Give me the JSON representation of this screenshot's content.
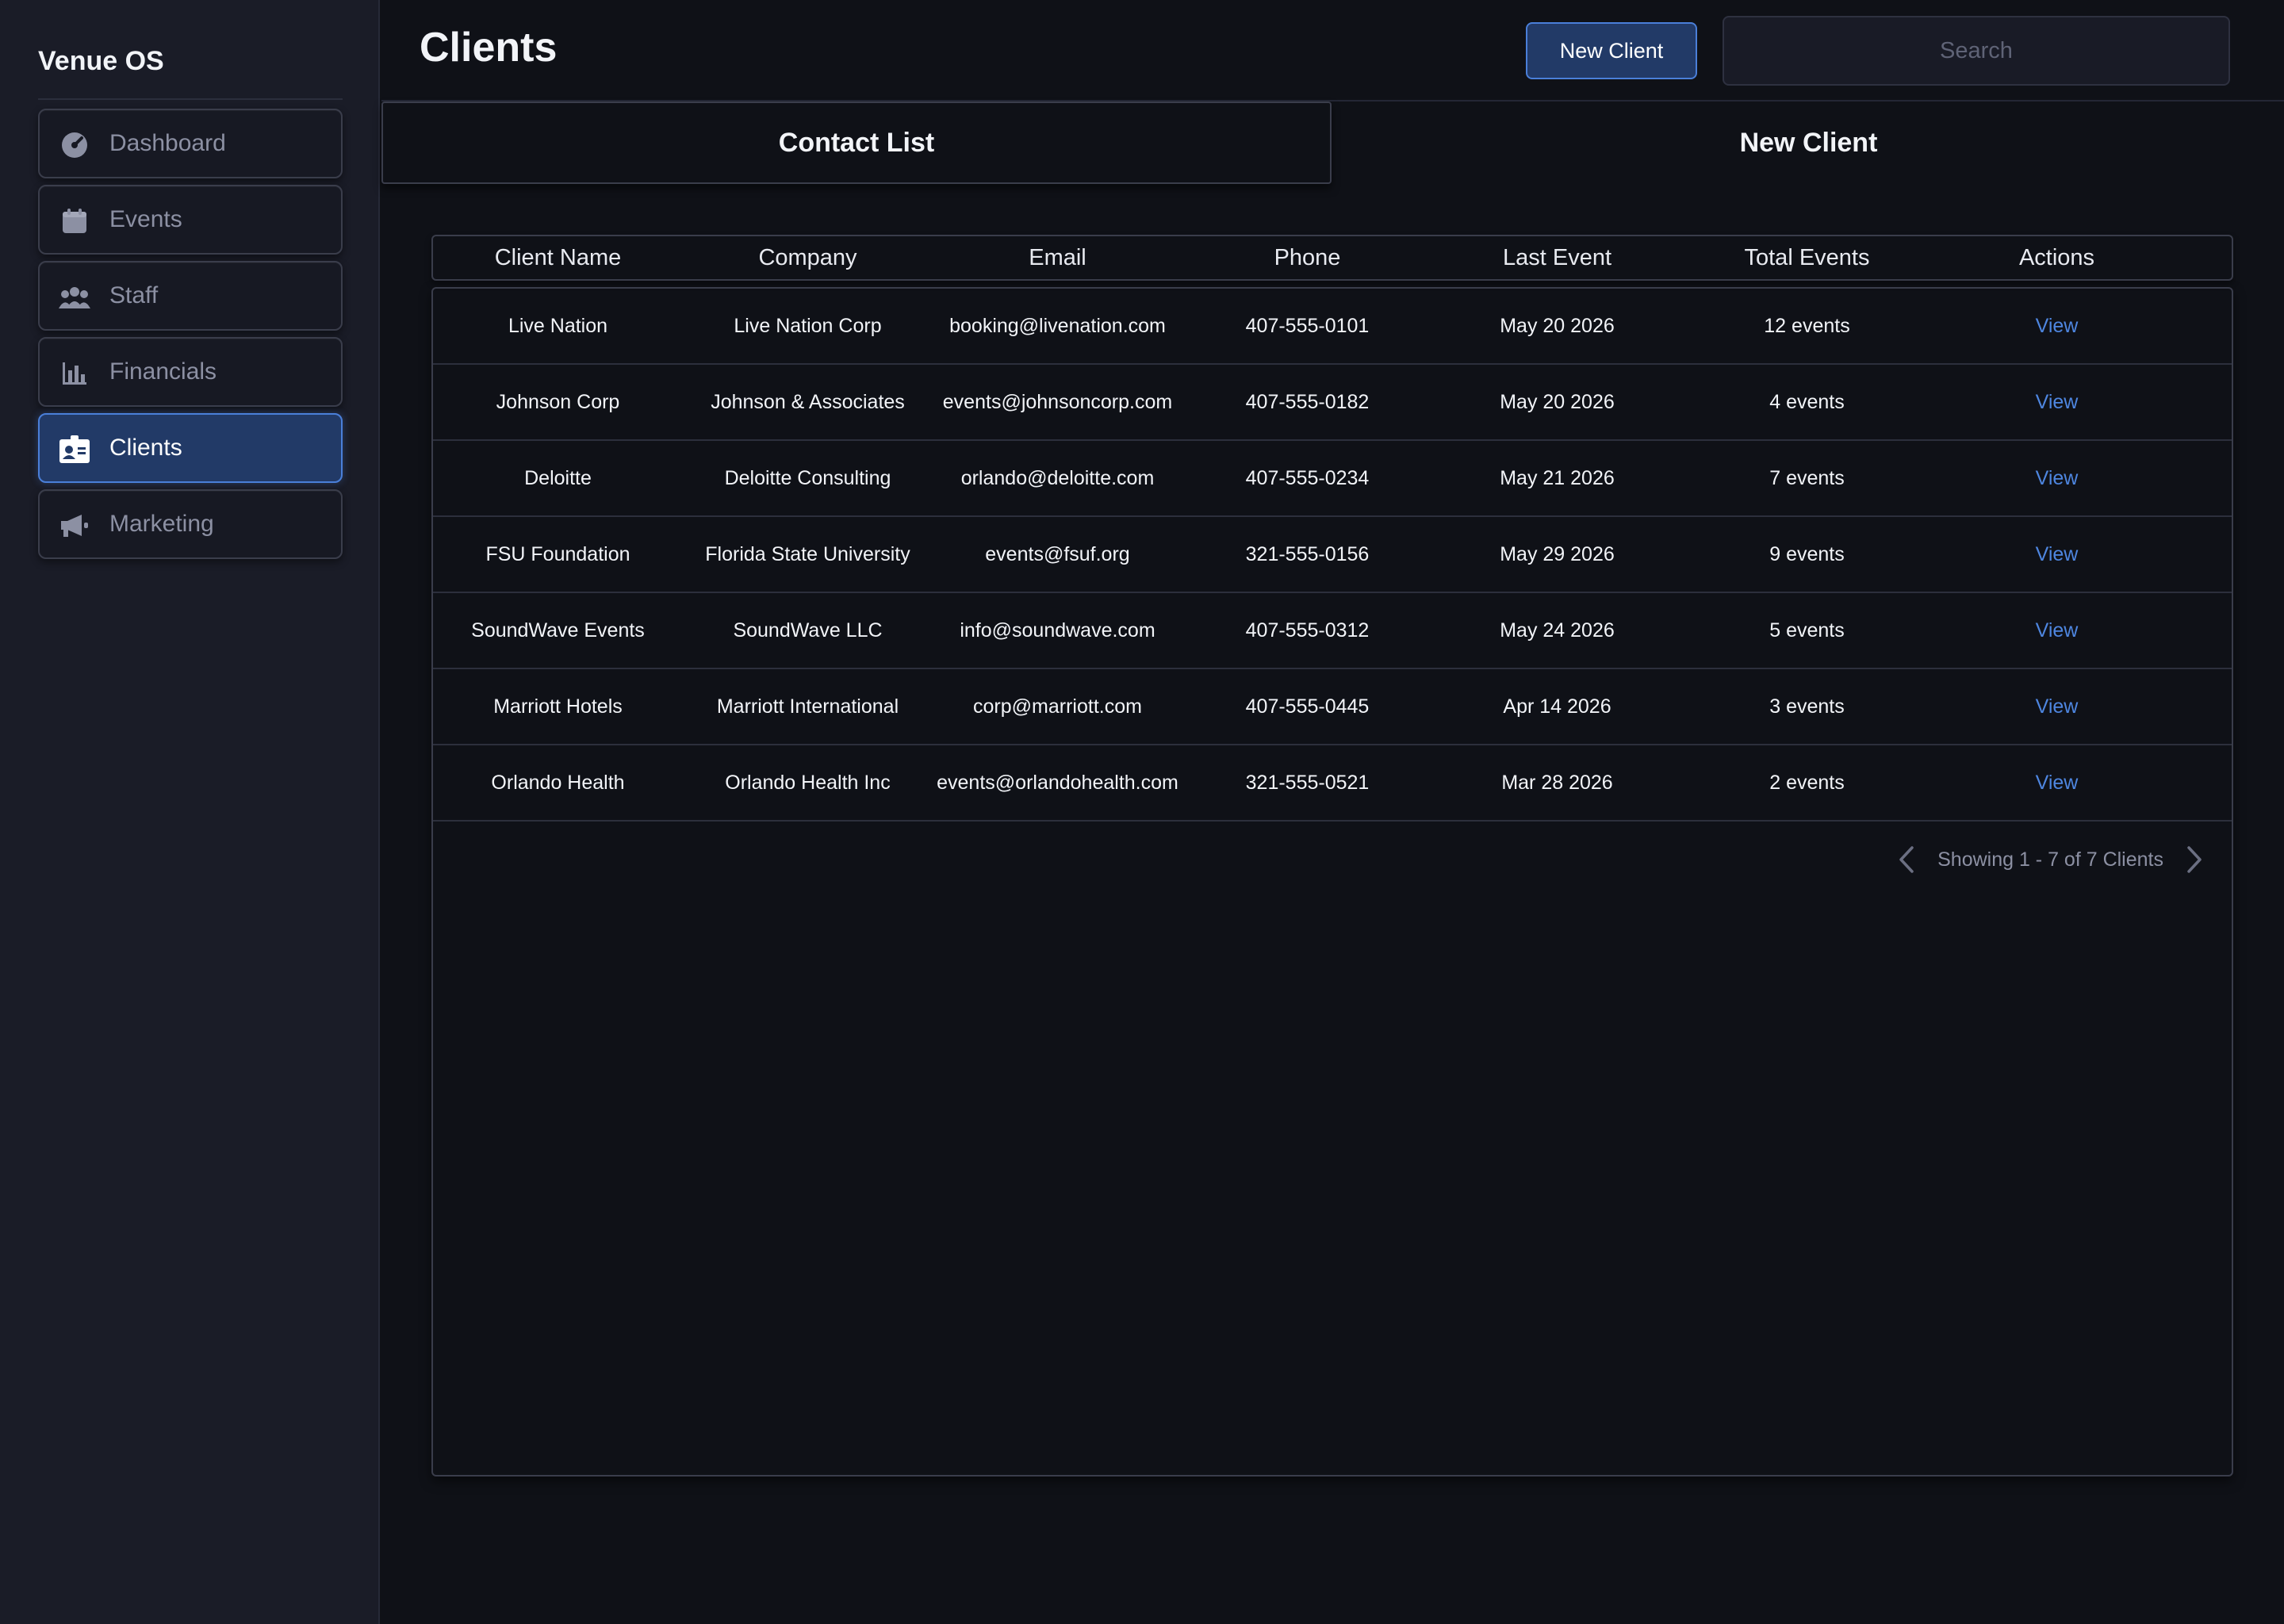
{
  "app": {
    "brand": "Venue OS"
  },
  "sidebar": {
    "items": [
      {
        "label": "Dashboard",
        "icon": "dashboard-gauge-icon",
        "active": false
      },
      {
        "label": "Events",
        "icon": "calendar-icon",
        "active": false
      },
      {
        "label": "Staff",
        "icon": "users-icon",
        "active": false
      },
      {
        "label": "Financials",
        "icon": "bar-chart-icon",
        "active": false
      },
      {
        "label": "Clients",
        "icon": "contact-card-icon",
        "active": true
      },
      {
        "label": "Marketing",
        "icon": "megaphone-icon",
        "active": false
      }
    ]
  },
  "header": {
    "title": "Clients",
    "new_client_label": "New Client",
    "search_placeholder": "Search"
  },
  "tabs": [
    {
      "label": "Contact List",
      "active": true
    },
    {
      "label": "New Client",
      "active": false
    }
  ],
  "table": {
    "columns": [
      "Client Name",
      "Company",
      "Email",
      "Phone",
      "Last Event",
      "Total Events",
      "Actions"
    ],
    "rows": [
      [
        "Live Nation",
        "Live Nation Corp",
        "booking@livenation.com",
        "407-555-0101",
        "May 20 2026",
        "12 events",
        "View"
      ],
      [
        "Johnson Corp",
        "Johnson & Associates",
        "events@johnsoncorp.com",
        "407-555-0182",
        "May 20 2026",
        "4 events",
        "View"
      ],
      [
        "Deloitte",
        "Deloitte Consulting",
        "orlando@deloitte.com",
        "407-555-0234",
        "May 21 2026",
        "7 events",
        "View"
      ],
      [
        "FSU Foundation",
        "Florida State University",
        "events@fsuf.org",
        "321-555-0156",
        "May 29 2026",
        "9 events",
        "View"
      ],
      [
        "SoundWave Events",
        "SoundWave LLC",
        "info@soundwave.com",
        "407-555-0312",
        "May 24 2026",
        "5 events",
        "View"
      ],
      [
        "Marriott Hotels",
        "Marriott International",
        "corp@marriott.com",
        "407-555-0445",
        "Apr 14 2026",
        "3 events",
        "View"
      ],
      [
        "Orlando Health",
        "Orlando Health Inc",
        "events@orlandohealth.com",
        "321-555-0521",
        "Mar 28 2026",
        "2 events",
        "View"
      ]
    ]
  },
  "pagination": {
    "text": "Showing 1 - 7 of 7 Clients"
  },
  "colors": {
    "background": "#0f1117",
    "sidebar": "#1a1c27",
    "accent": "#4a7fd9",
    "active_fill": "#223a67",
    "link": "#4e86e0"
  }
}
